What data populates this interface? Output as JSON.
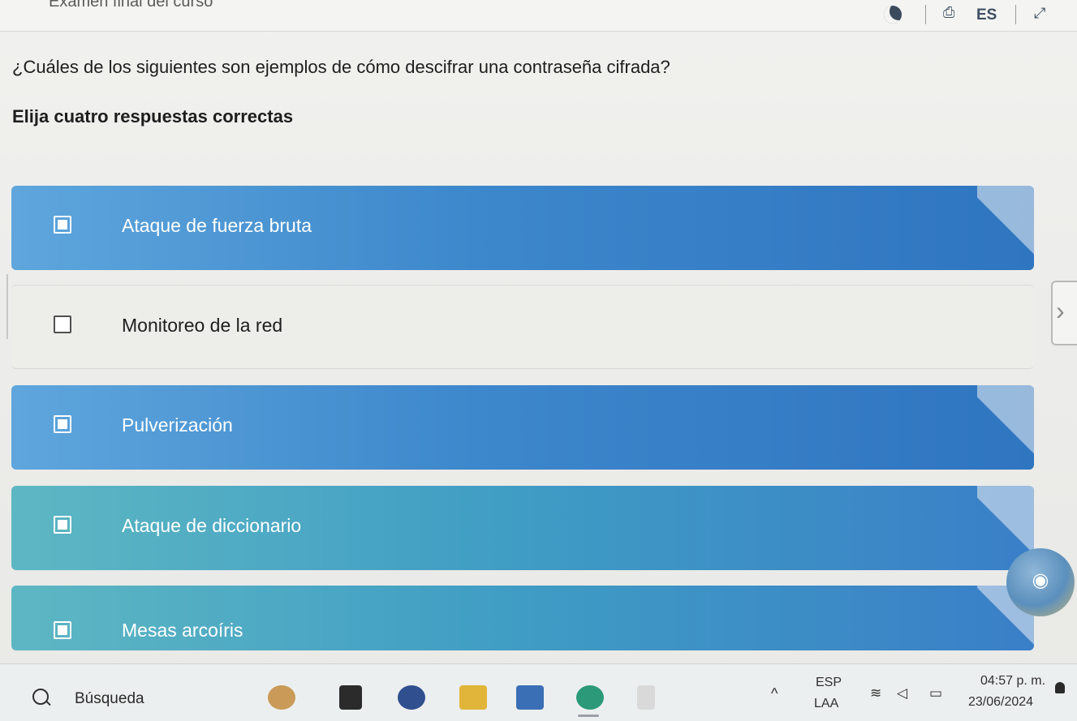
{
  "header": {
    "exam_title": "Examen final del curso",
    "language_code": "ES",
    "icons": [
      "moon-icon",
      "translate-icon",
      "expand-icon"
    ]
  },
  "question": {
    "text": "¿Cuáles de los siguientes son ejemplos de cómo descifrar una contraseña cifrada?",
    "instruction": "Elija cuatro respuestas correctas"
  },
  "options": [
    {
      "label": "Ataque de fuerza bruta",
      "selected": true
    },
    {
      "label": "Monitoreo de la red",
      "selected": false
    },
    {
      "label": "Pulverización",
      "selected": true
    },
    {
      "label": "Ataque de diccionario",
      "selected": true
    },
    {
      "label": "Mesas arcoíris",
      "selected": true
    }
  ],
  "navigation": {
    "next_glyph": "›"
  },
  "taskbar": {
    "search_label": "Búsqueda",
    "tray_lang_top": "ESP",
    "tray_lang_bottom": "LAA",
    "time": "04:57 p. m.",
    "date": "23/06/2024",
    "chevron_glyph": "^",
    "wifi_glyph": "≋",
    "volume_glyph": "◁",
    "battery_glyph": "▭"
  },
  "colors": {
    "selected_option": "#3d87cc",
    "unselected_option": "#ededea"
  }
}
